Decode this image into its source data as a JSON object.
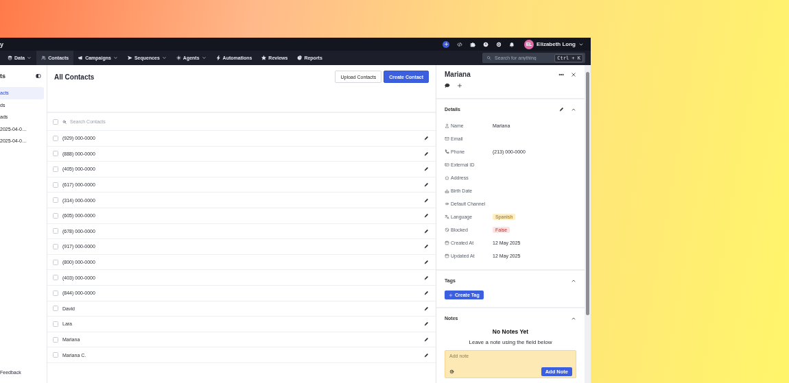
{
  "brand": {
    "text": "y"
  },
  "topbar": {
    "user": {
      "initials": "EL",
      "name": "Elizabeth Long"
    }
  },
  "nav": {
    "items": [
      {
        "label": "Data",
        "kind": "data",
        "dropdown": true,
        "selected": false
      },
      {
        "label": "Contacts",
        "kind": "contacts",
        "dropdown": false,
        "selected": true
      },
      {
        "label": "Campaigns",
        "kind": "campaigns",
        "dropdown": true,
        "selected": false
      },
      {
        "label": "Sequences",
        "kind": "sequences",
        "dropdown": true,
        "selected": false
      },
      {
        "label": "Agents",
        "kind": "agents",
        "dropdown": true,
        "selected": false
      },
      {
        "label": "Automations",
        "kind": "automations",
        "dropdown": false,
        "selected": false
      },
      {
        "label": "Reviews",
        "kind": "reviews",
        "dropdown": false,
        "selected": false
      },
      {
        "label": "Reports",
        "kind": "reports",
        "dropdown": false,
        "selected": false
      }
    ],
    "search": {
      "placeholder": "Search for anything",
      "shortcut": "Ctrl + K"
    }
  },
  "sidebar": {
    "title": "ts",
    "items": [
      {
        "label": "acts",
        "selected": true
      },
      {
        "label": "ds",
        "selected": false
      },
      {
        "label": "ads",
        "selected": false
      },
      {
        "label": "2025-04-0…",
        "selected": false
      },
      {
        "label": "2025-04-0…",
        "selected": false
      }
    ],
    "footer": "Feedback"
  },
  "main": {
    "title": "All Contacts",
    "buttons": [
      {
        "label": "Upload Contacts",
        "kind": "secondary"
      },
      {
        "label": "Create Contact",
        "kind": "primary"
      }
    ],
    "search": {
      "placeholder": "Search Contacts",
      "checked": false
    },
    "rows": [
      {
        "label": "(929) 000-0000",
        "checked": false
      },
      {
        "label": "(888) 000-0000",
        "checked": false
      },
      {
        "label": "(405) 000-0000",
        "checked": false
      },
      {
        "label": "(617) 000-0000",
        "checked": false
      },
      {
        "label": "(314) 000-0000",
        "checked": false
      },
      {
        "label": "(605) 000-0000",
        "checked": false
      },
      {
        "label": "(678) 000-0000",
        "checked": false
      },
      {
        "label": "(917) 000-0000",
        "checked": false
      },
      {
        "label": "(800) 000-0000",
        "checked": false
      },
      {
        "label": "(403) 000-0000",
        "checked": false
      },
      {
        "label": "(844) 000-0000",
        "checked": false
      },
      {
        "label": "David",
        "checked": false
      },
      {
        "label": "Lara",
        "checked": false
      },
      {
        "label": "Mariana",
        "checked": false
      },
      {
        "label": "Mariana C.",
        "checked": false
      }
    ]
  },
  "panel": {
    "name": "Mariana",
    "sections": [
      {
        "kind": "details",
        "title": "Details",
        "expanded": true,
        "fields": [
          {
            "kind": "name",
            "label": "Name",
            "value": "Mariana"
          },
          {
            "kind": "email",
            "label": "Email"
          },
          {
            "kind": "phone",
            "label": "Phone",
            "value": "(213) 000-0000"
          },
          {
            "kind": "external",
            "label": "External ID"
          },
          {
            "kind": "address",
            "label": "Address"
          },
          {
            "kind": "birthday",
            "label": "Birth Date"
          },
          {
            "kind": "channel",
            "label": "Default Channel"
          },
          {
            "kind": "language",
            "label": "Language",
            "value": "Spanish"
          },
          {
            "kind": "blocked",
            "label": "Blocked",
            "value": "False"
          },
          {
            "kind": "date",
            "label": "Created At",
            "value": "12 May 2025"
          },
          {
            "kind": "date",
            "label": "Updated At",
            "value": "12 May 2025"
          }
        ]
      },
      {
        "kind": "tags",
        "title": "Tags",
        "expanded": true,
        "button": "Create Tag"
      },
      {
        "kind": "notes",
        "title": "Notes",
        "expanded": true,
        "empty_title": "No Notes Yet",
        "empty_hint": "Leave a note using the field below",
        "placeholder": "Add note",
        "button": "Add Note"
      }
    ]
  }
}
